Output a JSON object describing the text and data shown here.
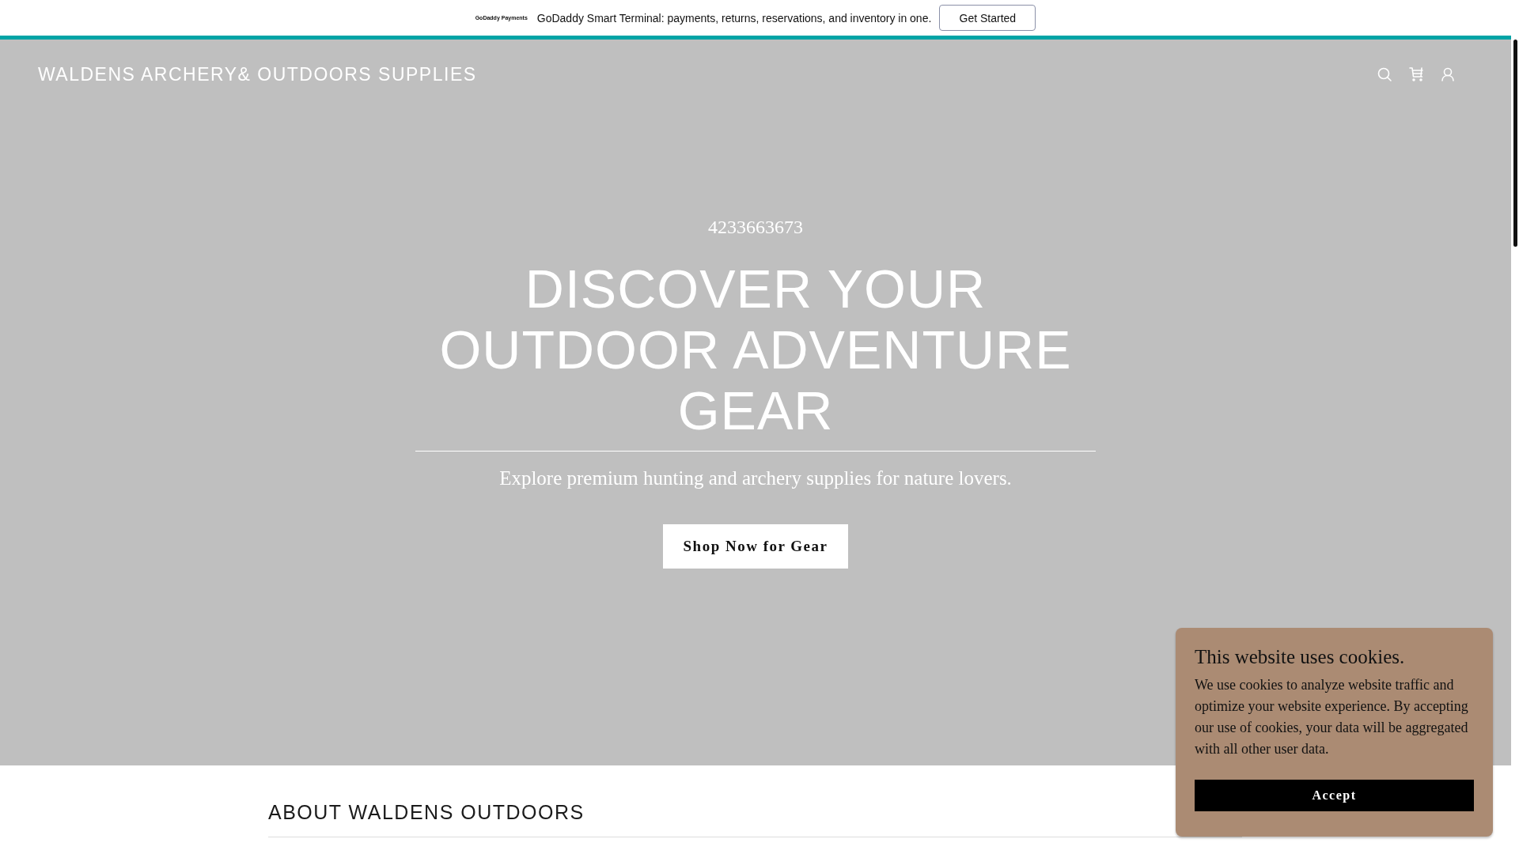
{
  "promo_banner": {
    "logo": "GoDaddy Payments",
    "message": "GoDaddy Smart Terminal: payments, returns, reservations, and inventory in one.",
    "button": "Get Started"
  },
  "header": {
    "site_title": "WALDENS ARCHERY& OUTDOORS SUPPLIES"
  },
  "hero": {
    "phone": "4233663673",
    "heading": "DISCOVER YOUR OUTDOOR ADVENTURE GEAR",
    "subtitle": "Explore premium hunting and archery supplies for nature lovers.",
    "button": "Shop Now for Gear"
  },
  "about": {
    "heading": "ABOUT WALDENS OUTDOORS"
  },
  "cookie_notice": {
    "title": "This website uses cookies.",
    "body": "We use cookies to analyze website traffic and optimize your website experience. By accepting our use of cookies, your data will be aggregated with all other user data.",
    "button": "Accept"
  }
}
